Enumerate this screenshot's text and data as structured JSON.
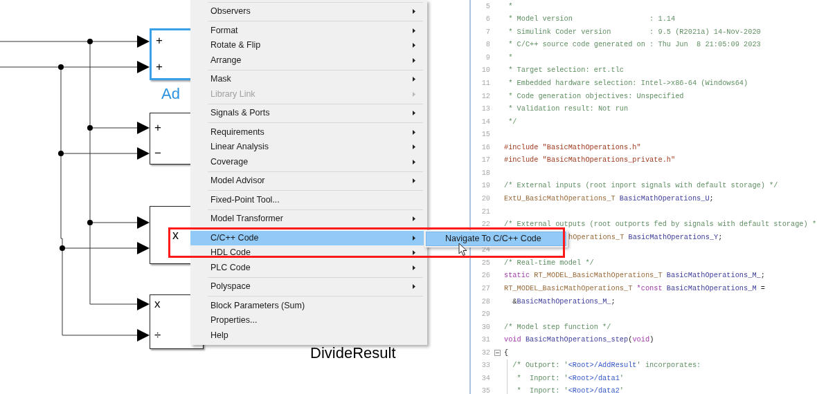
{
  "canvas": {
    "blocks": [
      {
        "kind": "ports",
        "ports": [
          "+",
          "+"
        ],
        "selected": true,
        "label": "Ad"
      },
      {
        "kind": "ports",
        "ports": [
          "+",
          "−"
        ],
        "selected": false
      },
      {
        "kind": "symbol",
        "symbol": "x",
        "selected": false
      },
      {
        "kind": "ports",
        "ports": [
          "x",
          "÷"
        ],
        "selected": false
      }
    ],
    "caption": "DivideResult"
  },
  "context_menu": {
    "groups": [
      [
        {
          "label": "Observers",
          "submenu": true,
          "disabled": false,
          "selected": false
        }
      ],
      [
        {
          "label": "Format",
          "submenu": true,
          "disabled": false,
          "selected": false
        },
        {
          "label": "Rotate & Flip",
          "submenu": true,
          "disabled": false,
          "selected": false
        },
        {
          "label": "Arrange",
          "submenu": true,
          "disabled": false,
          "selected": false
        }
      ],
      [
        {
          "label": "Mask",
          "submenu": true,
          "disabled": false,
          "selected": false
        },
        {
          "label": "Library Link",
          "submenu": true,
          "disabled": true,
          "selected": false
        }
      ],
      [
        {
          "label": "Signals & Ports",
          "submenu": true,
          "disabled": false,
          "selected": false
        }
      ],
      [
        {
          "label": "Requirements",
          "submenu": true,
          "disabled": false,
          "selected": false
        },
        {
          "label": "Linear Analysis",
          "submenu": true,
          "disabled": false,
          "selected": false
        },
        {
          "label": "Coverage",
          "submenu": true,
          "disabled": false,
          "selected": false
        }
      ],
      [
        {
          "label": "Model Advisor",
          "submenu": true,
          "disabled": false,
          "selected": false
        }
      ],
      [
        {
          "label": "Fixed-Point Tool...",
          "submenu": false,
          "disabled": false,
          "selected": false
        }
      ],
      [
        {
          "label": "Model Transformer",
          "submenu": true,
          "disabled": false,
          "selected": false
        }
      ],
      [
        {
          "label": "C/C++ Code",
          "submenu": true,
          "disabled": false,
          "selected": true
        },
        {
          "label": "HDL Code",
          "submenu": true,
          "disabled": false,
          "selected": false
        },
        {
          "label": "PLC Code",
          "submenu": true,
          "disabled": false,
          "selected": false
        }
      ],
      [
        {
          "label": "Polyspace",
          "submenu": true,
          "disabled": false,
          "selected": false
        }
      ],
      [
        {
          "label": "Block Parameters (Sum)",
          "submenu": false,
          "disabled": false,
          "selected": false
        },
        {
          "label": "Properties...",
          "submenu": false,
          "disabled": false,
          "selected": false
        },
        {
          "label": "Help",
          "submenu": false,
          "disabled": false,
          "selected": false
        }
      ]
    ],
    "submenu": {
      "items": [
        {
          "label": "Navigate To C/C++ Code",
          "selected": true
        }
      ]
    }
  },
  "code": {
    "lines": [
      {
        "number": "5",
        "tokens": [
          {
            "kind": "comment",
            "text": " *"
          }
        ]
      },
      {
        "number": "6",
        "tokens": [
          {
            "kind": "comment",
            "text": " * Model version                  : 1.14"
          }
        ]
      },
      {
        "number": "7",
        "tokens": [
          {
            "kind": "comment",
            "text": " * Simulink Coder version         : 9.5 (R2021a) 14-Nov-2020"
          }
        ]
      },
      {
        "number": "8",
        "tokens": [
          {
            "kind": "comment",
            "text": " * C/C++ source code generated on : Thu Jun  8 21:05:09 2023"
          }
        ]
      },
      {
        "number": "9",
        "tokens": [
          {
            "kind": "comment",
            "text": " *"
          }
        ]
      },
      {
        "number": "10",
        "tokens": [
          {
            "kind": "comment",
            "text": " * Target selection: ert.tlc"
          }
        ]
      },
      {
        "number": "11",
        "tokens": [
          {
            "kind": "comment",
            "text": " * Embedded hardware selection: Intel->x86-64 (Windows64)"
          }
        ]
      },
      {
        "number": "12",
        "tokens": [
          {
            "kind": "comment",
            "text": " * Code generation objectives: Unspecified"
          }
        ]
      },
      {
        "number": "13",
        "tokens": [
          {
            "kind": "comment",
            "text": " * Validation result: Not run"
          }
        ]
      },
      {
        "number": "14",
        "tokens": [
          {
            "kind": "comment",
            "text": " */"
          }
        ]
      },
      {
        "number": "15"
      },
      {
        "number": "16",
        "tokens": [
          {
            "kind": "preproc",
            "text": "#include \"BasicMathOperations.h\""
          }
        ]
      },
      {
        "number": "17",
        "tokens": [
          {
            "kind": "preproc",
            "text": "#include \"BasicMathOperations_private.h\""
          }
        ]
      },
      {
        "number": "18"
      },
      {
        "number": "19",
        "tokens": [
          {
            "kind": "comment",
            "text": "/* External inputs (root inport signals with default storage) */"
          }
        ]
      },
      {
        "number": "20",
        "tokens": [
          {
            "kind": "type",
            "text": "ExtU_BasicMathOperations_T "
          },
          {
            "kind": "ident",
            "text": "BasicMathOperations_U"
          },
          {
            "kind": "plain",
            "text": ";"
          }
        ]
      },
      {
        "number": "21"
      },
      {
        "number": "22",
        "tokens": [
          {
            "kind": "comment",
            "text": "/* External outputs (root outports fed by signals with default storage) *"
          }
        ]
      },
      {
        "clipped": true,
        "tokens": [
          {
            "kind": "type",
            "text": "hOperations_T "
          },
          {
            "kind": "ident",
            "text": "BasicMathOperations_Y"
          },
          {
            "kind": "plain",
            "text": ";"
          }
        ]
      },
      {
        "number": "24"
      },
      {
        "number": "25",
        "tokens": [
          {
            "kind": "comment",
            "text": "/* Real-time model */"
          }
        ]
      },
      {
        "number": "26",
        "tokens": [
          {
            "kind": "keyword",
            "text": "static "
          },
          {
            "kind": "type",
            "text": "RT_MODEL_BasicMathOperations_T "
          },
          {
            "kind": "ident",
            "text": "BasicMathOperations_M_"
          },
          {
            "kind": "plain",
            "text": ";"
          }
        ]
      },
      {
        "number": "27",
        "tokens": [
          {
            "kind": "type",
            "text": "RT_MODEL_BasicMathOperations_T "
          },
          {
            "kind": "keyword",
            "text": "*const "
          },
          {
            "kind": "ident",
            "text": "BasicMathOperations_M"
          },
          {
            "kind": "plain",
            "text": " ="
          }
        ]
      },
      {
        "number": "28",
        "tokens": [
          {
            "kind": "plain",
            "text": "  &"
          },
          {
            "kind": "ident",
            "text": "BasicMathOperations_M_"
          },
          {
            "kind": "plain",
            "text": ";"
          }
        ]
      },
      {
        "number": "29"
      },
      {
        "number": "30",
        "tokens": [
          {
            "kind": "comment",
            "text": "/* Model step function */"
          }
        ]
      },
      {
        "number": "31",
        "tokens": [
          {
            "kind": "keyword",
            "text": "void "
          },
          {
            "kind": "ident",
            "text": "BasicMathOperations_step"
          },
          {
            "kind": "plain",
            "text": "("
          },
          {
            "kind": "keyword",
            "text": "void"
          },
          {
            "kind": "plain",
            "text": ")"
          }
        ]
      },
      {
        "number": "32",
        "fold": true,
        "tokens": [
          {
            "kind": "plain",
            "text": "{"
          }
        ]
      },
      {
        "number": "33",
        "guide": true,
        "tokens": [
          {
            "kind": "comment",
            "text": "  /* Outport: '"
          },
          {
            "kind": "ref",
            "text": "<Root>/AddResult"
          },
          {
            "kind": "comment",
            "text": "' incorporates:"
          }
        ]
      },
      {
        "number": "34",
        "guide": true,
        "tokens": [
          {
            "kind": "comment",
            "text": "   *  Inport: '"
          },
          {
            "kind": "ref",
            "text": "<Root>/data1"
          },
          {
            "kind": "comment",
            "text": "'"
          }
        ]
      },
      {
        "number": "35",
        "guide": true,
        "tokens": [
          {
            "kind": "comment",
            "text": "   *  Inport: '"
          },
          {
            "kind": "ref",
            "text": "<Root>/data2"
          },
          {
            "kind": "comment",
            "text": "'"
          }
        ]
      }
    ]
  }
}
